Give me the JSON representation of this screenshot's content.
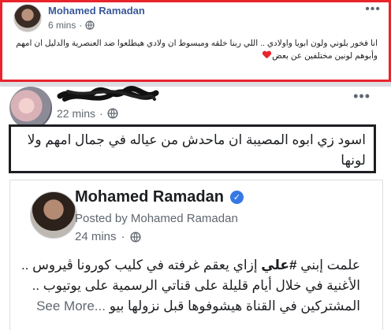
{
  "post1": {
    "author": "Mohamed Ramadan",
    "time": "6 mins",
    "text": "انا فخور بلوني ولون ابويا واولادي .. اللي ربنا خلقه ومبسوط ان ولادي هيطلعوا ضد العنصرية والدليل ان امهم وأبوهم لونين مختلفين عن بعض"
  },
  "post2": {
    "time": "22 mins",
    "text": "اسود زي ابوه المصيبة ان ماحدش من عياله في جمال امهم ولا لونها"
  },
  "shared": {
    "author": "Mohamed Ramadan",
    "posted_by": "Posted by Mohamed Ramadan",
    "time": "24 mins",
    "text_line1_pre": "علمت إبني ",
    "hashtag": "#علي",
    "text_line1_post": " إزاي يعقم غرفته في كليب كورونا ڤيروس ..",
    "text_line2": "الأغنية في خلال أيام قليلة على قناتي الرسمية على يوتيوب ..",
    "text_line3_post": " المشتركين في القناة هيشوفوها قبل نزولها بيو",
    "see_more": "See More..."
  },
  "colors": {
    "red_frame": "#e8242c",
    "link_blue": "#385898",
    "verified_blue": "#3578e5"
  },
  "icons": {
    "privacy": "globe-icon",
    "options": "more-options-icon",
    "verified": "verified-badge-icon"
  }
}
